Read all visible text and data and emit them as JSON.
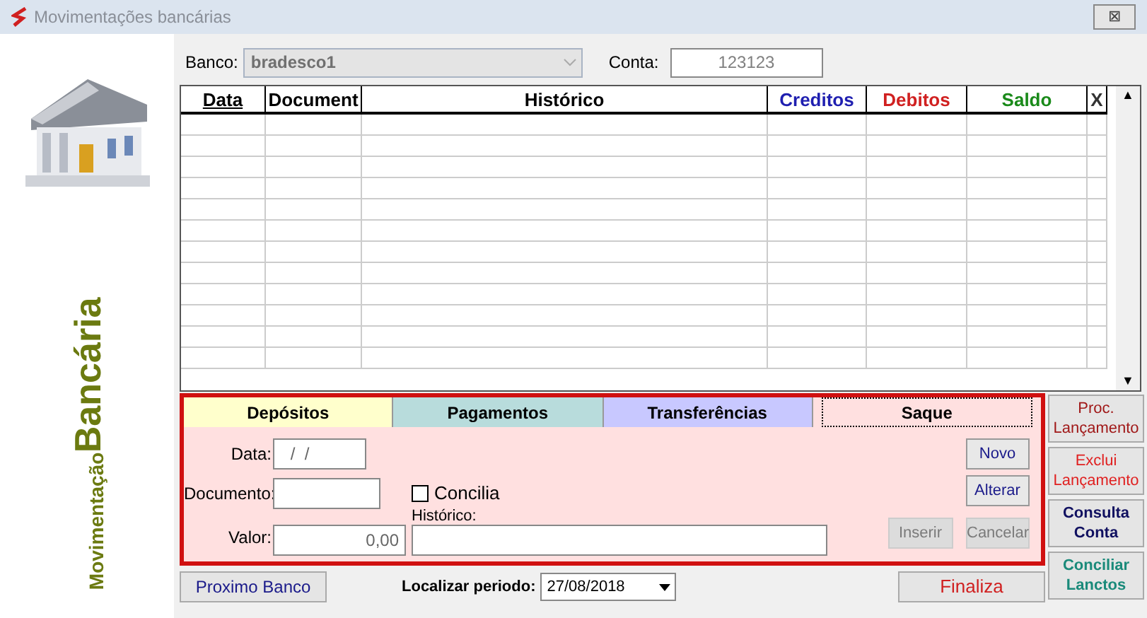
{
  "window": {
    "title": "Movimentações bancárias",
    "close": "⊠"
  },
  "side_title": {
    "line1": "Movimentação",
    "line2": "Bancária"
  },
  "bank": {
    "label": "Banco:",
    "value": "bradesco1",
    "disabled": true
  },
  "account": {
    "label": "Conta:",
    "value": "123123"
  },
  "table": {
    "columns": [
      {
        "label": "Data",
        "color": "#000000"
      },
      {
        "label": "Document",
        "color": "#000000"
      },
      {
        "label": "Histórico",
        "color": "#000000"
      },
      {
        "label": "Creditos",
        "color": "#1f1fb0"
      },
      {
        "label": "Debitos",
        "color": "#d02020"
      },
      {
        "label": "Saldo",
        "color": "#1a8a1a"
      },
      {
        "label": "X",
        "color": "#333333"
      }
    ],
    "scroll_up": "▲",
    "scroll_down": "▼"
  },
  "tabs": [
    {
      "label": "Depósitos",
      "color": "#ffffcc",
      "selected": false
    },
    {
      "label": "Pagamentos",
      "color": "#b8dcdc",
      "selected": false
    },
    {
      "label": "Transferências",
      "color": "#c8c8ff",
      "selected": false
    },
    {
      "label": "Saque",
      "color": "#ffe0e0",
      "selected": true
    }
  ],
  "form": {
    "date_label": "Data:",
    "date_value": " /  /",
    "document_label": "Documento:",
    "value_label": "Valor:",
    "value": "0,00",
    "history_label": "Histórico:",
    "concilia": {
      "label": "Concilia",
      "checked": false
    }
  },
  "form_buttons": [
    {
      "label": "Novo",
      "disabled": false
    },
    {
      "label": "Alterar",
      "disabled": false
    },
    {
      "label": "Inserir",
      "disabled": true
    },
    {
      "label": "Cancelar",
      "disabled": true
    }
  ],
  "side_buttons": [
    {
      "label": "Proc. Lançamento",
      "color": "#a01818",
      "bold": false
    },
    {
      "label": "Exclui Lançamento",
      "color": "#e02020",
      "bold": false
    },
    {
      "label": "Consulta Conta",
      "color": "#101060",
      "bold": true
    },
    {
      "label": "Conciliar Lanctos",
      "color": "#1a8a7a",
      "bold": true
    }
  ],
  "footer": {
    "next_bank": "Proximo Banco",
    "period_label": "Localizar periodo:",
    "period_value": "27/08/2018",
    "finish": "Finaliza"
  }
}
